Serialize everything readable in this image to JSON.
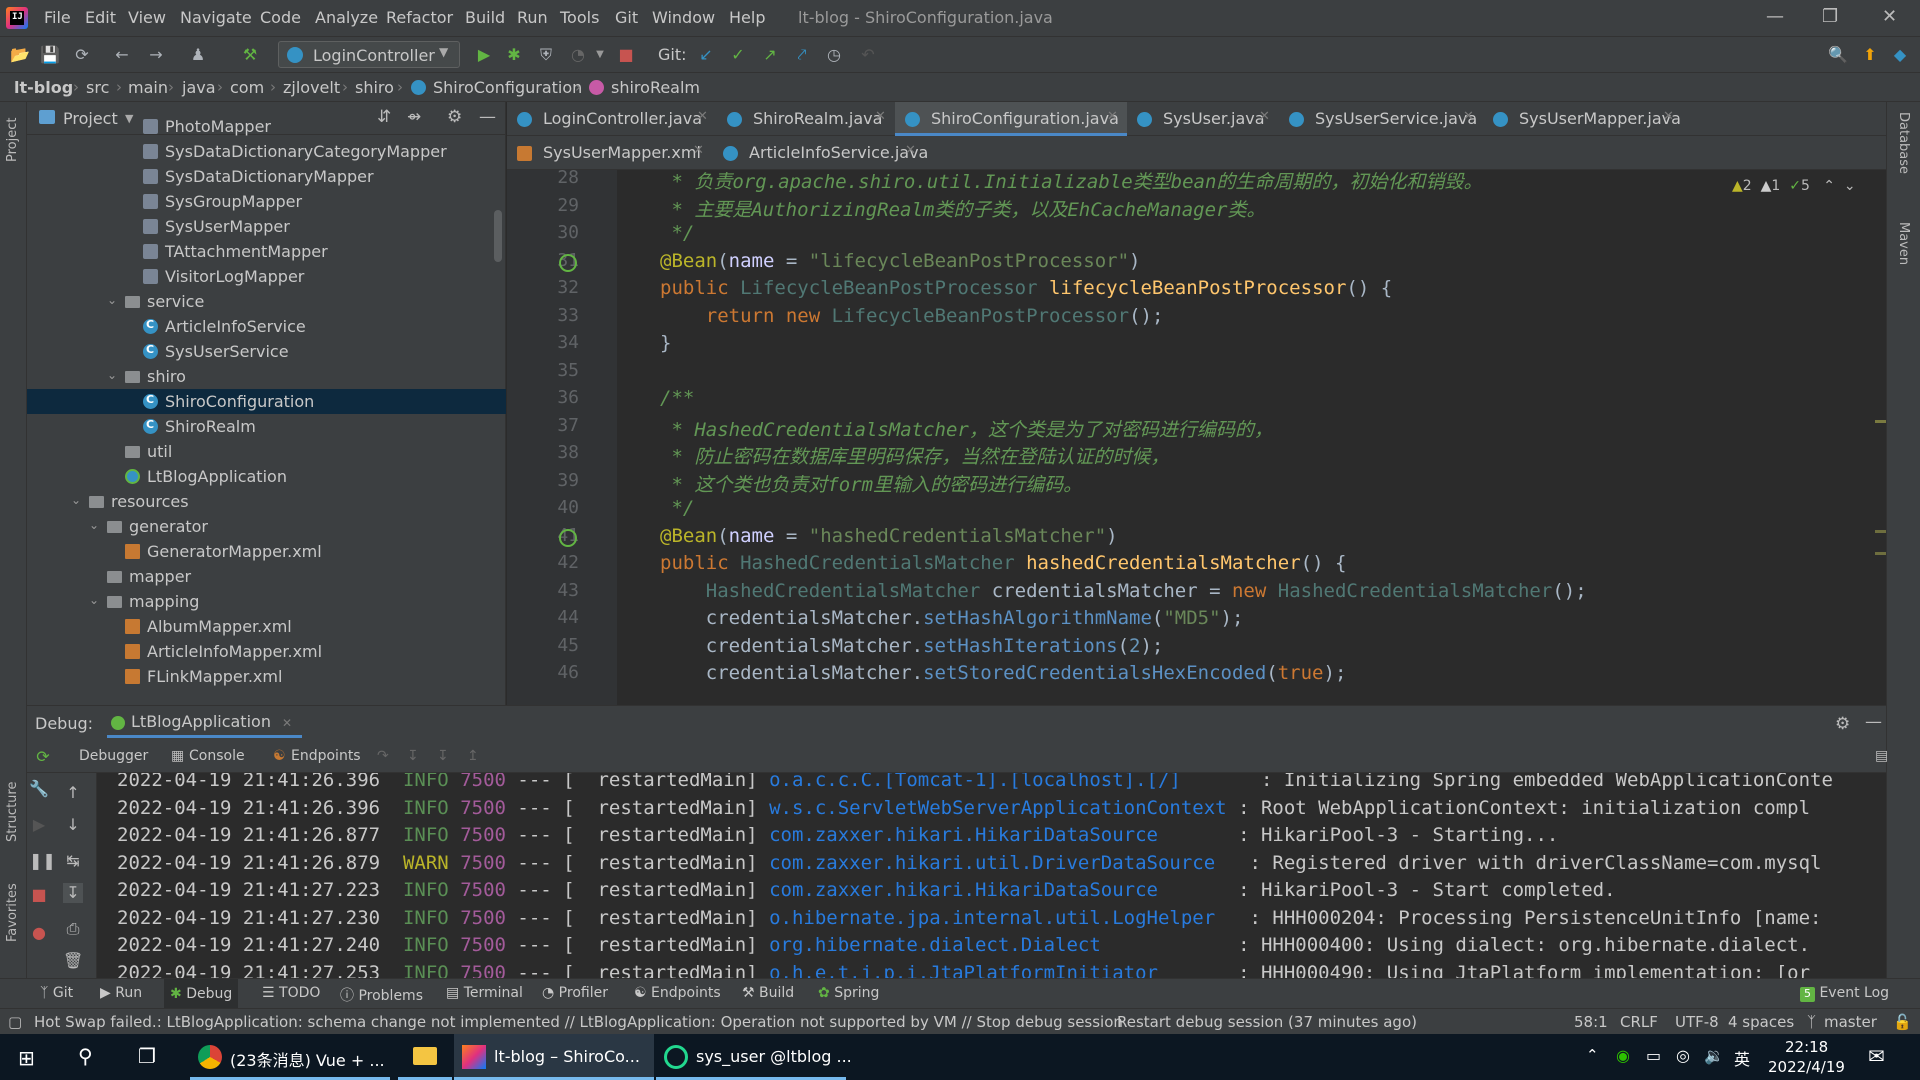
{
  "menubar": {
    "items": [
      "File",
      "Edit",
      "View",
      "Navigate",
      "Code",
      "Analyze",
      "Refactor",
      "Build",
      "Run",
      "Tools",
      "Git",
      "Window",
      "Help"
    ],
    "window_title": "lt-blog - ShiroConfiguration.java"
  },
  "toolbar": {
    "run_config": "LoginController",
    "git_label": "Git:"
  },
  "breadcrumb": [
    "lt-blog",
    "src",
    "main",
    "java",
    "com",
    "zjlovelt",
    "shiro",
    "ShiroConfiguration",
    "shiroRealm"
  ],
  "project": {
    "title": "Project",
    "tree": [
      {
        "label": "PhotoMapper",
        "type": "mapper",
        "indent": 3
      },
      {
        "label": "SysDataDictionaryCategoryMapper",
        "type": "mapper",
        "indent": 3
      },
      {
        "label": "SysDataDictionaryMapper",
        "type": "mapper",
        "indent": 3
      },
      {
        "label": "SysGroupMapper",
        "type": "mapper",
        "indent": 3
      },
      {
        "label": "SysUserMapper",
        "type": "mapper",
        "indent": 3
      },
      {
        "label": "TAttachmentMapper",
        "type": "mapper",
        "indent": 3
      },
      {
        "label": "VisitorLogMapper",
        "type": "mapper",
        "indent": 3
      },
      {
        "label": "service",
        "type": "folder",
        "indent": 2,
        "expanded": true
      },
      {
        "label": "ArticleInfoService",
        "type": "class",
        "indent": 3
      },
      {
        "label": "SysUserService",
        "type": "class",
        "indent": 3
      },
      {
        "label": "shiro",
        "type": "folder",
        "indent": 2,
        "expanded": true
      },
      {
        "label": "ShiroConfiguration",
        "type": "class",
        "indent": 3,
        "selected": true
      },
      {
        "label": "ShiroRealm",
        "type": "class",
        "indent": 3
      },
      {
        "label": "util",
        "type": "folder",
        "indent": 2
      },
      {
        "label": "LtBlogApplication",
        "type": "app",
        "indent": 2
      },
      {
        "label": "resources",
        "type": "folder",
        "indent": 0,
        "expanded": true
      },
      {
        "label": "generator",
        "type": "folder",
        "indent": 1,
        "expanded": true
      },
      {
        "label": "GeneratorMapper.xml",
        "type": "xml",
        "indent": 2
      },
      {
        "label": "mapper",
        "type": "folder",
        "indent": 1
      },
      {
        "label": "mapping",
        "type": "folder",
        "indent": 1,
        "expanded": true
      },
      {
        "label": "AlbumMapper.xml",
        "type": "xml",
        "indent": 2
      },
      {
        "label": "ArticleInfoMapper.xml",
        "type": "xml",
        "indent": 2
      },
      {
        "label": "FLinkMapper.xml",
        "type": "xml",
        "indent": 2
      }
    ]
  },
  "tabs_row1": [
    {
      "label": "LoginController.java",
      "type": "class"
    },
    {
      "label": "ShiroRealm.java",
      "type": "class"
    },
    {
      "label": "ShiroConfiguration.java",
      "type": "class",
      "active": true
    },
    {
      "label": "SysUser.java",
      "type": "class"
    },
    {
      "label": "SysUserService.java",
      "type": "class"
    },
    {
      "label": "SysUserMapper.java",
      "type": "class"
    }
  ],
  "tabs_row2": [
    {
      "label": "SysUserMapper.xml",
      "type": "xml"
    },
    {
      "label": "ArticleInfoService.java",
      "type": "class"
    }
  ],
  "editor": {
    "inspections": {
      "warnings": "2",
      "weak": "1",
      "ok": "5"
    },
    "line_numbers": [
      "28",
      "29",
      "30",
      "31",
      "32",
      "33",
      "34",
      "35",
      "36",
      "37",
      "38",
      "39",
      "40",
      "41",
      "42",
      "43",
      "44",
      "45",
      "46"
    ],
    "lines": [
      " * 负责org.apache.shiro.util.Initializable类型bean的生命周期的，初始化和销毁。",
      " * 主要是AuthorizingRealm类的子类，以及EhCacheManager类。",
      " */",
      "@Bean(name = \"lifecycleBeanPostProcessor\")",
      "public LifecycleBeanPostProcessor lifecycleBeanPostProcessor() {",
      "    return new LifecycleBeanPostProcessor();",
      "}",
      "",
      "/**",
      " * HashedCredentialsMatcher，这个类是为了对密码进行编码的，",
      " * 防止密码在数据库里明码保存，当然在登陆认证的时候，",
      " * 这个类也负责对form里输入的密码进行编码。",
      " */",
      "@Bean(name = \"hashedCredentialsMatcher\")",
      "public HashedCredentialsMatcher hashedCredentialsMatcher() {",
      "    HashedCredentialsMatcher credentialsMatcher = new HashedCredentialsMatcher();",
      "    credentialsMatcher.setHashAlgorithmName(\"MD5\");",
      "    credentialsMatcher.setHashIterations(2);",
      "    credentialsMatcher.setStoredCredentialsHexEncoded(true);"
    ]
  },
  "debug": {
    "label": "Debug:",
    "session": "LtBlogApplication",
    "subtabs": [
      "Debugger",
      "Console",
      "Endpoints"
    ],
    "log": [
      {
        "ts": "2022-04-19 21:41:26.396",
        "level": "INFO",
        "pid": "7500",
        "sep": "---",
        "thread": "[  restartedMain]",
        "logger": "o.a.c.c.C.[Tomcat-1].[localhost].[/]      ",
        "msg": ": Initializing Spring embedded WebApplicationConte"
      },
      {
        "ts": "2022-04-19 21:41:26.396",
        "level": "INFO",
        "pid": "7500",
        "sep": "---",
        "thread": "[  restartedMain]",
        "logger": "w.s.c.ServletWebServerApplicationContext",
        "msg": ": Root WebApplicationContext: initialization compl"
      },
      {
        "ts": "2022-04-19 21:41:26.877",
        "level": "INFO",
        "pid": "7500",
        "sep": "---",
        "thread": "[  restartedMain]",
        "logger": "com.zaxxer.hikari.HikariDataSource      ",
        "msg": ": HikariPool-3 - Starting..."
      },
      {
        "ts": "2022-04-19 21:41:26.879",
        "level": "WARN",
        "pid": "7500",
        "sep": "---",
        "thread": "[  restartedMain]",
        "logger": "com.zaxxer.hikari.util.DriverDataSource  ",
        "msg": ": Registered driver with driverClassName=com.mysql"
      },
      {
        "ts": "2022-04-19 21:41:27.223",
        "level": "INFO",
        "pid": "7500",
        "sep": "---",
        "thread": "[  restartedMain]",
        "logger": "com.zaxxer.hikari.HikariDataSource      ",
        "msg": ": HikariPool-3 - Start completed."
      },
      {
        "ts": "2022-04-19 21:41:27.230",
        "level": "INFO",
        "pid": "7500",
        "sep": "---",
        "thread": "[  restartedMain]",
        "logger": "o.hibernate.jpa.internal.util.LogHelper  ",
        "msg": ": HHH000204: Processing PersistenceUnitInfo [name:"
      },
      {
        "ts": "2022-04-19 21:41:27.240",
        "level": "INFO",
        "pid": "7500",
        "sep": "---",
        "thread": "[  restartedMain]",
        "logger": "org.hibernate.dialect.Dialect           ",
        "msg": ": HHH000400: Using dialect: org.hibernate.dialect."
      },
      {
        "ts": "2022-04-19 21:41:27.253",
        "level": "INFO",
        "pid": "7500",
        "sep": "---",
        "thread": "[  restartedMain]",
        "logger": "o.h.e.t.j.p.i.JtaPlatformInitiator      ",
        "msg": ": HHH000490: Using JtaPlatform implementation: [or"
      }
    ]
  },
  "bottom_tools": [
    "Git",
    "Run",
    "Debug",
    "TODO",
    "Problems",
    "Terminal",
    "Profiler",
    "Endpoints",
    "Build",
    "Spring"
  ],
  "event_log": {
    "count": "5",
    "label": "Event Log"
  },
  "status": {
    "message": "Hot Swap failed.: LtBlogApplication: schema change not implemented // LtBlogApplication: Operation not supported by VM // Stop debug session",
    "restart": "Restart debug session (37 minutes ago)",
    "position": "58:1",
    "line_sep": "CRLF",
    "encoding": "UTF-8",
    "indent": "4 spaces",
    "branch": "master"
  },
  "side_labels": {
    "project": "Project",
    "structure": "Structure",
    "favorites": "Favorites",
    "database": "Database",
    "maven": "Maven"
  },
  "taskbar": {
    "apps": [
      {
        "label": "(23条消息) Vue + ...",
        "icon": "chrome-icon"
      },
      {
        "label": "",
        "icon": "file-explorer-icon"
      },
      {
        "label": "lt-blog – ShiroCo...",
        "icon": "intellij-icon",
        "active": true
      },
      {
        "label": "sys_user @ltblog ...",
        "icon": "datagrip-icon"
      }
    ],
    "ime": "英",
    "time": "22:18",
    "date": "2022/4/19"
  }
}
